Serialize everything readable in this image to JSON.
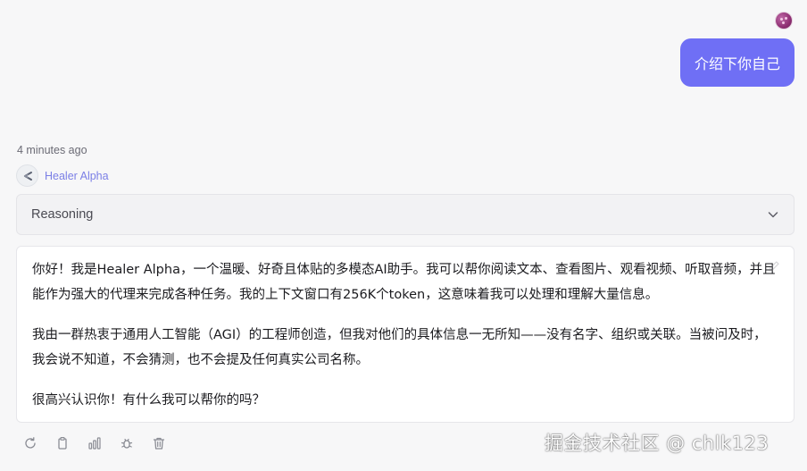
{
  "user_message": {
    "text": "介绍下你自己"
  },
  "assistant": {
    "timestamp": "4 minutes ago",
    "name": "Healer Alpha",
    "reasoning_label": "Reasoning",
    "paragraphs": [
      "你好！我是Healer Alpha，一个温暖、好奇且体贴的多模态AI助手。我可以帮你阅读文本、查看图片、观看视频、听取音频，并且能作为强大的代理来完成各种任务。我的上下文窗口有256K个token，这意味着我可以处理和理解大量信息。",
      "我由一群热衷于通用人工智能（AGI）的工程师创造，但我对他们的具体信息一无所知——没有名字、组织或关联。当被问及时，我会说不知道，不会猜测，也不会提及任何真实公司名称。",
      "很高兴认识你！有什么我可以帮你的吗？"
    ]
  },
  "actions": [
    {
      "name": "regenerate-icon"
    },
    {
      "name": "copy-icon"
    },
    {
      "name": "stats-icon"
    },
    {
      "name": "bug-icon"
    },
    {
      "name": "delete-icon"
    }
  ],
  "watermark": "掘金技术社区 @ chlk123",
  "colors": {
    "accent": "#6f6ff5",
    "bot_name": "#7b7fe6",
    "background": "#f7f7f8"
  }
}
